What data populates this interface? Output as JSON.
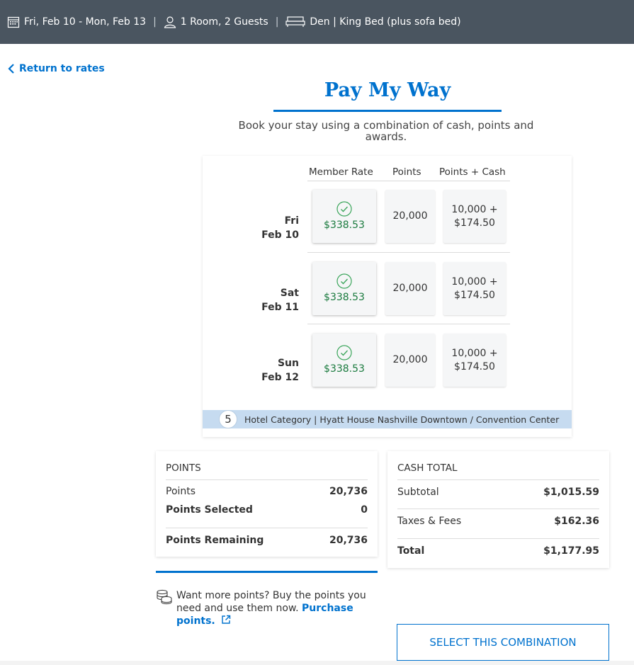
{
  "header": {
    "dates": "Fri, Feb 10 - Mon, Feb 13",
    "rooms": "1 Room, 2 Guests",
    "room_type": "Den | King Bed (plus sofa bed)",
    "separator": "|"
  },
  "back_link": {
    "label": "Return to rates"
  },
  "title": "Pay My Way",
  "subtitle": "Book your stay using a combination of cash, points and awards.",
  "table": {
    "columns": [
      "Member Rate",
      "Points",
      "Points + Cash"
    ],
    "rows": [
      {
        "day": "Fri",
        "date": "Feb 10",
        "member_rate": "$338.53",
        "points": "20,000",
        "pc_points": "10,000 +",
        "pc_cash": "$174.50"
      },
      {
        "day": "Sat",
        "date": "Feb 11",
        "member_rate": "$338.53",
        "points": "20,000",
        "pc_points": "10,000 +",
        "pc_cash": "$174.50"
      },
      {
        "day": "Sun",
        "date": "Feb 12",
        "member_rate": "$338.53",
        "points": "20,000",
        "pc_points": "10,000 +",
        "pc_cash": "$174.50"
      }
    ]
  },
  "category": {
    "number": "5",
    "text": "Hotel Category | Hyatt House Nashville Downtown / Convention Center"
  },
  "points_panel": {
    "title": "POINTS",
    "points_label": "Points",
    "points_value": "20,736",
    "selected_label": "Points Selected",
    "selected_value": "0",
    "remaining_label": "Points Remaining",
    "remaining_value": "20,736"
  },
  "cash_panel": {
    "title": "CASH TOTAL",
    "subtotal_label": "Subtotal",
    "subtotal_value": "$1,015.59",
    "taxes_label": "Taxes & Fees",
    "taxes_value": "$162.36",
    "total_label": "Total",
    "total_value": "$1,177.95"
  },
  "promo": {
    "text": "Want more points? Buy the points you need and use them now.",
    "link": "Purchase points."
  },
  "select_button": "SELECT THIS COMBINATION",
  "colors": {
    "accent": "#0072ce",
    "header_bg": "#4a5560",
    "selected_green": "#1a7a3e",
    "category_bg": "#c6dbf0"
  },
  "icons": [
    "calendar-icon",
    "person-icon",
    "bed-icon",
    "chevron-left-icon",
    "check-circle-icon",
    "coins-icon",
    "external-link-icon"
  ]
}
